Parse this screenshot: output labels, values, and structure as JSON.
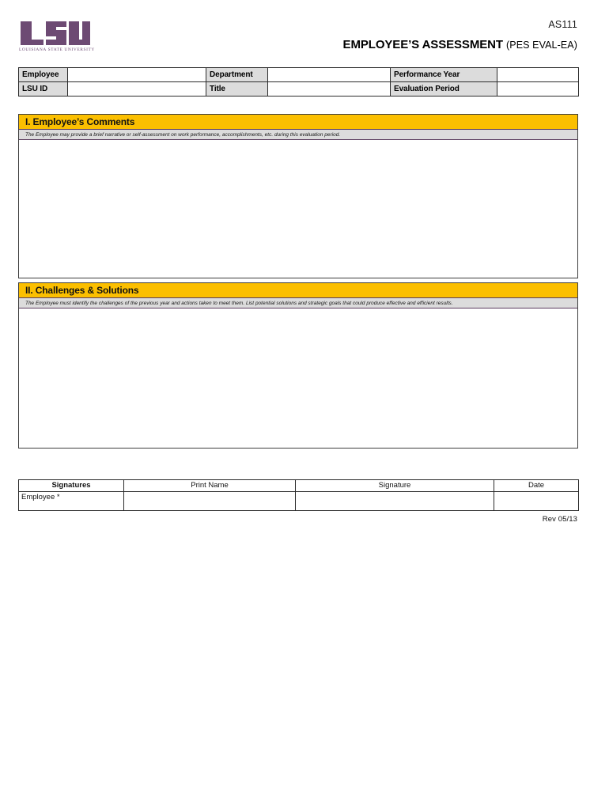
{
  "header": {
    "form_code": "AS111",
    "title": "EMPLOYEE’S ASSESSMENT",
    "subtitle": "(PES EVAL-EA)",
    "logo": {
      "wordmark": "LSU",
      "tagline": "Louisiana State University",
      "color": "#6d4a73"
    }
  },
  "info_table": {
    "rows": [
      {
        "label_1": "Employee",
        "value_1": "",
        "label_2": "Department",
        "value_2": "",
        "label_3": "Performance Year",
        "value_3": ""
      },
      {
        "label_1": "LSU ID",
        "value_1": "",
        "label_2": "Title",
        "value_2": "",
        "label_3": "Evaluation Period",
        "value_3": ""
      }
    ]
  },
  "sections": [
    {
      "id": "section-1",
      "heading": "I.  Employee’s Comments",
      "instruction": "The Employee may provide a brief narrative or self-assessment on work performance, accomplishments, etc. during this evaluation period.",
      "body_text": ""
    },
    {
      "id": "section-2",
      "heading": "II.  Challenges & Solutions",
      "instruction": "The Employee must identify the challenges of the previous year and actions taken to meet them.  List potential solutions and strategic goals that could produce effective and efficient results.",
      "body_text": ""
    }
  ],
  "signature_table": {
    "headers": [
      "Signatures",
      "Print Name",
      "Signature",
      "Date"
    ],
    "rows": [
      {
        "role": "Employee *",
        "print_name": "",
        "signature": "",
        "date": ""
      }
    ]
  },
  "footer": {
    "revision": "Rev 05/13"
  },
  "colors": {
    "accent_yellow": "#fbbf00",
    "label_gray": "#dcdcdc",
    "logo_purple": "#6d4a73",
    "border_dark": "#2b2b2b"
  }
}
